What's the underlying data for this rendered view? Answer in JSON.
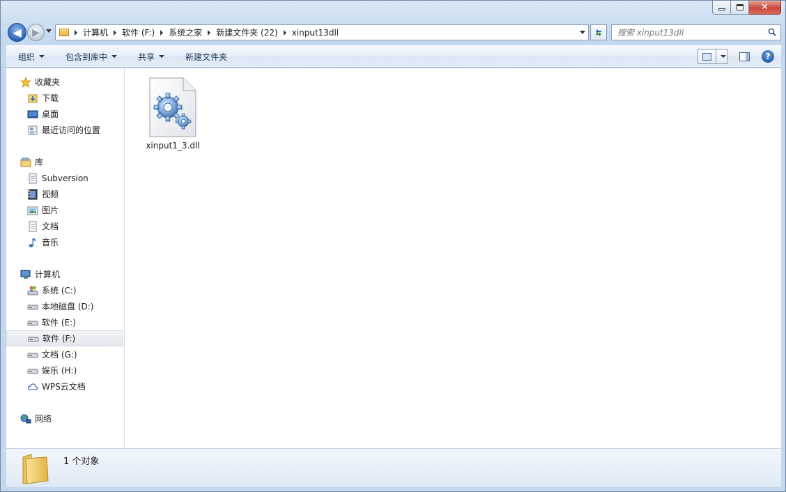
{
  "window": {
    "caption": {
      "close_glyph": "✕"
    }
  },
  "nav": {
    "back_glyph": "◀",
    "forward_glyph": "▶"
  },
  "breadcrumb": [
    "计算机",
    "软件 (F:)",
    "系统之家",
    "新建文件夹 (22)",
    "xinput13dll"
  ],
  "search": {
    "placeholder": "搜索 xinput13dll"
  },
  "toolbar": {
    "organize": "组织",
    "include_in_library": "包含到库中",
    "share": "共享",
    "new_folder": "新建文件夹",
    "help_glyph": "?"
  },
  "sidebar": {
    "favorites": {
      "label": "收藏夹",
      "items": [
        "下载",
        "桌面",
        "最近访问的位置"
      ]
    },
    "libraries": {
      "label": "库",
      "items": [
        "Subversion",
        "视频",
        "图片",
        "文档",
        "音乐"
      ]
    },
    "computer": {
      "label": "计算机",
      "items": [
        "系统 (C:)",
        "本地磁盘 (D:)",
        "软件 (E:)",
        "软件 (F:)",
        "文档 (G:)",
        "娱乐 (H:)",
        "WPS云文档"
      ],
      "selected": "软件 (F:)"
    },
    "network": {
      "label": "网络"
    }
  },
  "files": [
    {
      "name": "xinput1_3.dll",
      "icon": "dll-gear-icon"
    }
  ],
  "status": {
    "count_text": "1 个对象"
  },
  "colors": {
    "accent": "#2b64b9",
    "frame": "#c4d8ee",
    "close": "#c7483a",
    "folder": "#e5b53c"
  }
}
